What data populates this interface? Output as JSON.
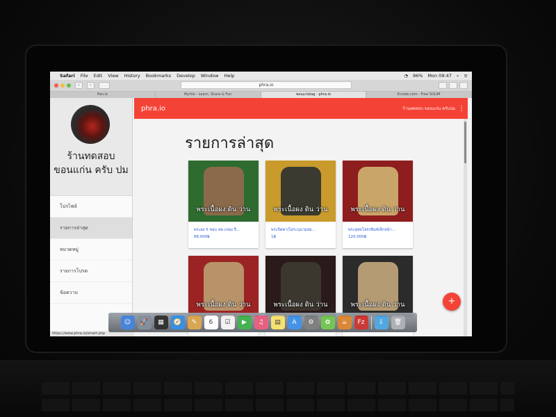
{
  "mac_menubar": {
    "app_name": "Safari",
    "menus": [
      "File",
      "Edit",
      "View",
      "History",
      "Bookmarks",
      "Develop",
      "Window",
      "Help"
    ],
    "battery": "96%",
    "clock": "Mon 09:47"
  },
  "browser": {
    "url": "phra.io",
    "tabs": [
      {
        "label": "Pen.io"
      },
      {
        "label": "Myrtle - Learn, Share & Fun"
      },
      {
        "label": "ขอนแก่นtag - phra.io"
      },
      {
        "label": "Ecolab.com - Free SOLIM"
      }
    ],
    "status_url": "https://www.phra.io/smart.php"
  },
  "drawer": {
    "shop_name": "ร้านทดสอบ ขอนแก่น ครับ ปม",
    "items": [
      {
        "label": "โปรไฟล์"
      },
      {
        "label": "รายการล่าสุด"
      },
      {
        "label": "หมวดหมู่"
      },
      {
        "label": "รายการโปรด"
      },
      {
        "label": "ข้อความ"
      }
    ]
  },
  "appbar": {
    "brand": "phra.io",
    "shop_link": "ร้านทดสอบ ขอนแก่น ครับปม",
    "more_icon": "⋮"
  },
  "main": {
    "heading": "รายการล่าสุด",
    "fab_icon": "+",
    "cards": [
      {
        "caption": "พระเนื้อผง ดิน ว่าน",
        "title": "พระผง 5 ขอบ ลพ.เกษม ปี...",
        "price": "88,000฿",
        "bg": "#2e6b2f",
        "amulet": "#8a6a4a"
      },
      {
        "caption": "พระเนื้อผง ดิน ว่าน",
        "title": "พระปิดตา(ไม่ระบุนามสม...",
        "price": "1฿",
        "bg": "#c99a2c",
        "amulet": "#3a3a30"
      },
      {
        "caption": "พระเนื้อผง ดิน ว่าน",
        "title": "พระพุทธโสธรพิมพ์เล็กหน้า...",
        "price": "120,000฿",
        "bg": "#8e1d1d",
        "amulet": "#caa56a"
      },
      {
        "caption": "พระเนื้อผง ดิน ว่าน",
        "title": "",
        "price": "",
        "bg": "#9c2323",
        "amulet": "#b8936a"
      },
      {
        "caption": "พระเนื้อผง ดิน ว่าน",
        "title": "",
        "price": "",
        "bg": "#2a1a1a",
        "amulet": "#3b372f"
      },
      {
        "caption": "พระเนื้อผง ดิน ว่าน",
        "title": "",
        "price": "",
        "bg": "#2b2b2b",
        "amulet": "#b59b74"
      }
    ]
  },
  "dock": {
    "apps": [
      "finder-icon",
      "launchpad-icon",
      "mission-control-icon",
      "safari-icon",
      "notes-icon",
      "calendar-icon",
      "reminders-icon",
      "facetime-icon",
      "itunes-icon",
      "stickies-icon",
      "app-store-icon",
      "system-preferences-icon",
      "coda-icon",
      "espresso-icon",
      "filezilla-icon",
      "downloads-icon",
      "trash-icon"
    ],
    "colors": [
      "#3f7fd6",
      "#7d8a99",
      "#2a2a2a",
      "#2e8ae6",
      "#d8a24a",
      "#ffffff",
      "#f2f2f2",
      "#3cae49",
      "#e65a7a",
      "#f5e06a",
      "#3a8ee6",
      "#7a7a7a",
      "#6dc24b",
      "#d9822b",
      "#c9302c",
      "#4aa3df",
      "#a9acb0"
    ],
    "glyphs": [
      "☺",
      "🚀",
      "▦",
      "🧭",
      "✎",
      "6",
      "☑",
      "▶",
      "♫",
      "▤",
      "A",
      "⚙",
      "✿",
      "☕",
      "Fz",
      "⇩",
      "🗑"
    ]
  }
}
